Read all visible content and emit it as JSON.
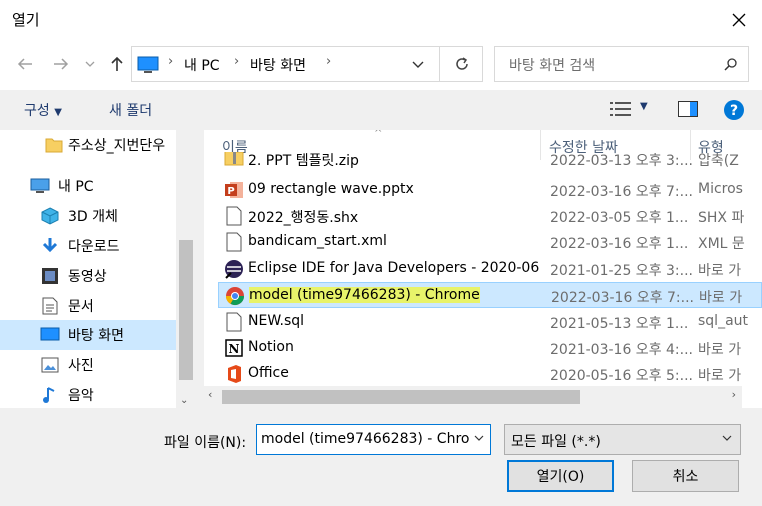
{
  "window": {
    "title": "열기"
  },
  "address": {
    "segments": [
      "내 PC",
      "바탕 화면"
    ]
  },
  "search": {
    "placeholder": "바탕 화면 검색"
  },
  "toolbar": {
    "organize": "구성",
    "new_folder": "새 폴더"
  },
  "sidebar": {
    "items": [
      {
        "label": "주소상_지번단우",
        "icon": "folder-icon"
      },
      {
        "label": "내 PC",
        "icon": "computer-icon"
      },
      {
        "label": "3D 개체",
        "icon": "3d-objects-icon"
      },
      {
        "label": "다운로드",
        "icon": "download-icon"
      },
      {
        "label": "동영상",
        "icon": "video-icon"
      },
      {
        "label": "문서",
        "icon": "document-icon"
      },
      {
        "label": "바탕 화면",
        "icon": "desktop-icon",
        "selected": true
      },
      {
        "label": "사진",
        "icon": "pictures-icon"
      },
      {
        "label": "음악",
        "icon": "music-icon"
      }
    ]
  },
  "columns": {
    "name": "이름",
    "date": "수정한 날짜",
    "type": "유형"
  },
  "files": [
    {
      "name": "2. PPT 템플릿.zip",
      "date": "2022-03-13 오후 3:...",
      "type": "압축(Z"
    },
    {
      "name": "09 rectangle wave.pptx",
      "date": "2022-03-16 오후 7:...",
      "type": "Micros"
    },
    {
      "name": "2022_행정동.shx",
      "date": "2022-03-05 오후 1...",
      "type": "SHX 파"
    },
    {
      "name": "bandicam_start.xml",
      "date": "2022-03-16 오후 1...",
      "type": "XML 문"
    },
    {
      "name": "Eclipse IDE for Java Developers - 2020-06",
      "date": "2021-01-25 오후 3:...",
      "type": "바로 가"
    },
    {
      "name": "model (time97466283) - Chrome",
      "date": "2022-03-16 오후 7:...",
      "type": "바로 가",
      "selected": true
    },
    {
      "name": "NEW.sql",
      "date": "2021-05-13 오후 1...",
      "type": "sql_aut"
    },
    {
      "name": "Notion",
      "date": "2021-03-16 오후 4:...",
      "type": "바로 가"
    },
    {
      "name": "Office",
      "date": "2020-05-16 오후 5:...",
      "type": "바로 가"
    }
  ],
  "bottom": {
    "filename_label": "파일 이름(N):",
    "filename_value": "model (time97466283) - Chrome",
    "filter_value": "모든 파일 (*.*)",
    "open_label": "열기(O)",
    "cancel_label": "취소"
  },
  "colors": {
    "selection": "#cce8ff",
    "accent": "#0078d7",
    "highlight": "#e8f36a"
  }
}
